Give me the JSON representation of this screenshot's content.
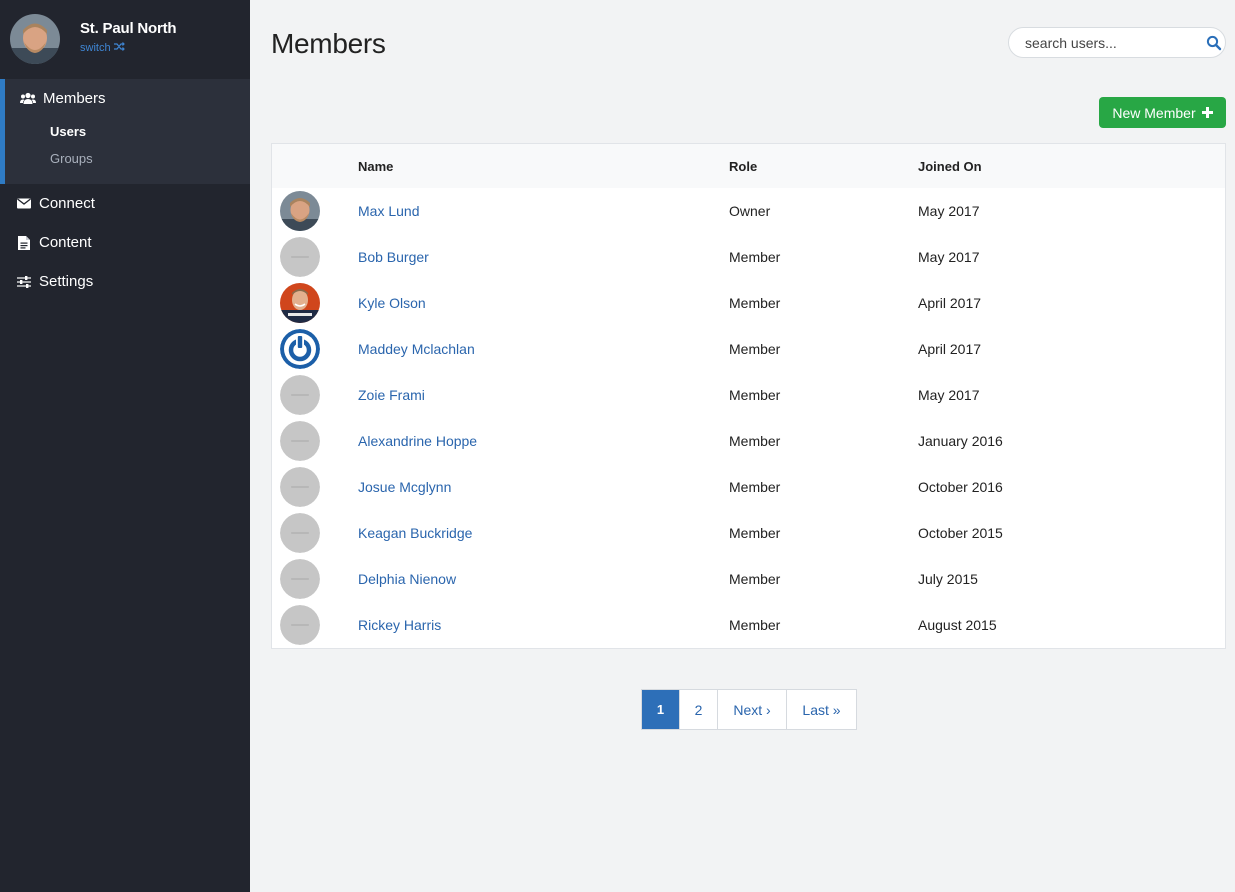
{
  "account": {
    "name": "St. Paul North",
    "switch_label": "switch"
  },
  "sidebar": {
    "members": {
      "label": "Members",
      "icon": "users-icon"
    },
    "subitems": [
      {
        "label": "Users"
      },
      {
        "label": "Groups"
      }
    ],
    "items": [
      {
        "label": "Connect",
        "icon": "envelope-icon"
      },
      {
        "label": "Content",
        "icon": "document-icon"
      },
      {
        "label": "Settings",
        "icon": "sliders-icon"
      }
    ]
  },
  "header": {
    "title": "Members"
  },
  "search": {
    "placeholder": "search users..."
  },
  "new_member": {
    "label": "New Member",
    "color": "#28a745"
  },
  "table": {
    "columns": {
      "name": "Name",
      "role": "Role",
      "joined": "Joined On"
    },
    "rows": [
      {
        "name": "Max Lund",
        "role": "Owner",
        "joined": "May 2017",
        "avatar": "photo-man-beard"
      },
      {
        "name": "Bob Burger",
        "role": "Member",
        "joined": "May 2017",
        "avatar": "placeholder"
      },
      {
        "name": "Kyle Olson",
        "role": "Member",
        "joined": "April 2017",
        "avatar": "photo-man-orange"
      },
      {
        "name": "Maddey Mclachlan",
        "role": "Member",
        "joined": "April 2017",
        "avatar": "power-logo"
      },
      {
        "name": "Zoie Frami",
        "role": "Member",
        "joined": "May 2017",
        "avatar": "placeholder"
      },
      {
        "name": "Alexandrine Hoppe",
        "role": "Member",
        "joined": "January 2016",
        "avatar": "placeholder"
      },
      {
        "name": "Josue Mcglynn",
        "role": "Member",
        "joined": "October 2016",
        "avatar": "placeholder"
      },
      {
        "name": "Keagan Buckridge",
        "role": "Member",
        "joined": "October 2015",
        "avatar": "placeholder"
      },
      {
        "name": "Delphia Nienow",
        "role": "Member",
        "joined": "July 2015",
        "avatar": "placeholder"
      },
      {
        "name": "Rickey Harris",
        "role": "Member",
        "joined": "August 2015",
        "avatar": "placeholder"
      }
    ]
  },
  "pagination": {
    "current": "1",
    "page2": "2",
    "next": "Next ›",
    "last": "Last »",
    "active_color": "#2d6fb8"
  },
  "colors": {
    "sidebar_bg": "#22252e",
    "link": "#2a65ad",
    "accent": "#2f7bc4"
  }
}
